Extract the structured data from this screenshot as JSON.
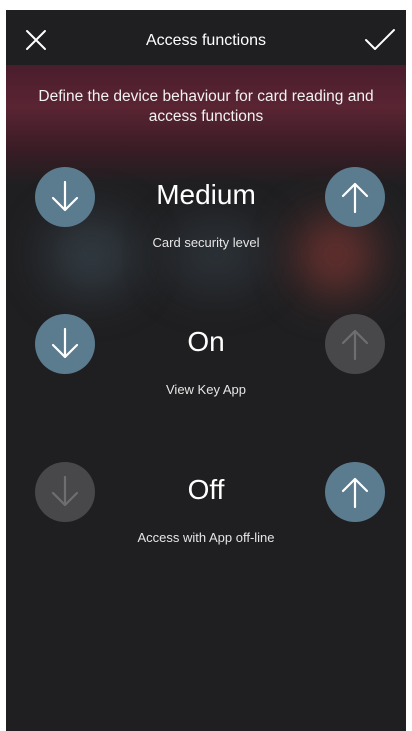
{
  "header": {
    "title": "Access functions",
    "close_icon": "close-icon",
    "confirm_icon": "checkmark-icon"
  },
  "subtitle": "Define the device behaviour for card reading and access functions",
  "settings": [
    {
      "value": "Medium",
      "label": "Card security level",
      "decrease_enabled": true,
      "increase_enabled": true
    },
    {
      "value": "On",
      "label": "View Key App",
      "decrease_enabled": true,
      "increase_enabled": false
    },
    {
      "value": "Off",
      "label": "Access with App off-line",
      "decrease_enabled": false,
      "increase_enabled": true
    }
  ],
  "colors": {
    "background": "#1f1f21",
    "button_active": "#5b7b8f",
    "button_disabled": "#48484b",
    "accent_glow": "#5a2433"
  }
}
